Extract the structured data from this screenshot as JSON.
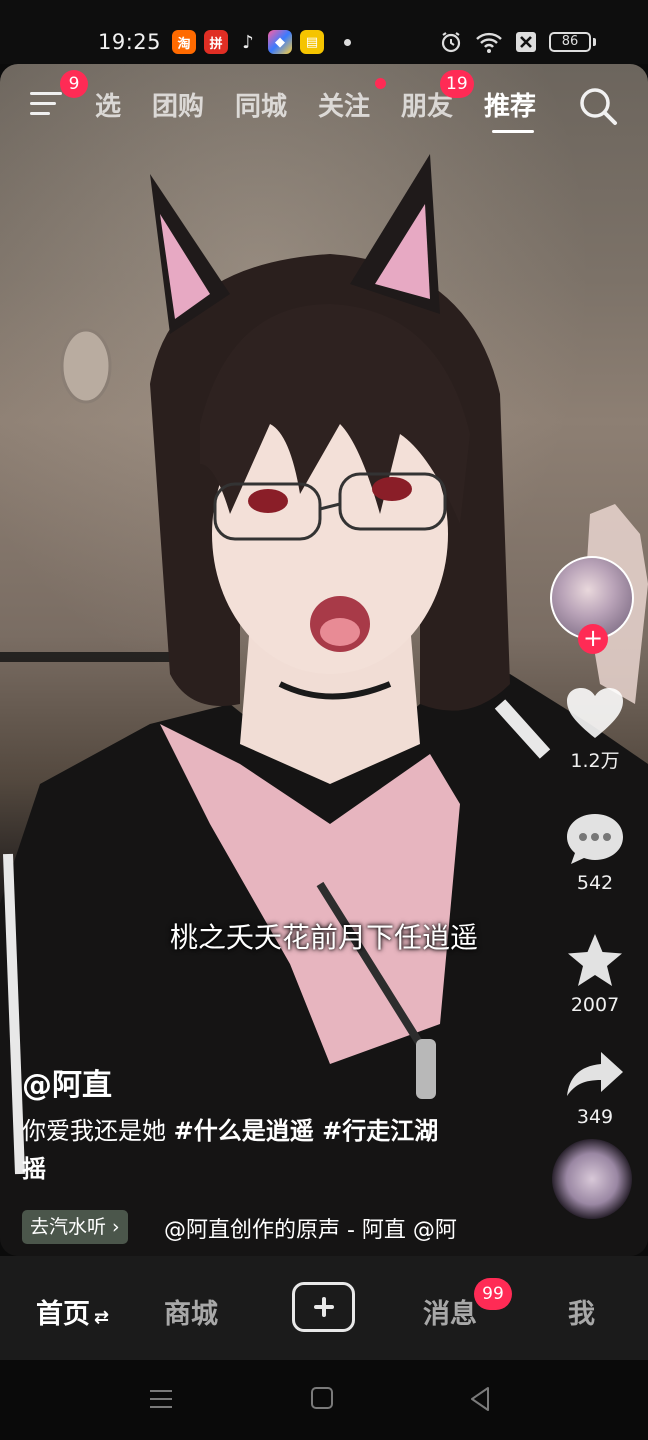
{
  "status_bar": {
    "time": "19:25",
    "app_icons": [
      {
        "name": "taobao-app-icon",
        "color": "#ff6a00",
        "glyph": "淘"
      },
      {
        "name": "pinduoduo-app-icon",
        "color": "#e02e24",
        "glyph": "拼"
      },
      {
        "name": "douyin-app-icon",
        "color": "#111111",
        "glyph": "♪"
      },
      {
        "name": "gallery-app-icon",
        "color": "#3a7bff",
        "glyph": "◆"
      },
      {
        "name": "notes-app-icon",
        "color": "#f5c400",
        "glyph": "▤"
      }
    ],
    "battery": "86"
  },
  "top_nav": {
    "menu_badge": "9",
    "tabs": [
      "精选",
      "团购",
      "同城",
      "关注",
      "朋友",
      "推荐"
    ],
    "tab_visible": [
      "选",
      "团购",
      "同城",
      "关注",
      "朋友",
      "推荐"
    ],
    "active_tab": "推荐",
    "friends_badge": "19"
  },
  "video": {
    "subtitle": "桃之夭夭花前月下任逍遥",
    "author": "@阿直",
    "caption_text": "你爱我还是她 ",
    "hashtag_1": "#什么是逍遥",
    "hashtag_2": " #行走江湖",
    "caption_wrap": "摇",
    "listen_label": "去汽水听 ›",
    "music": "@阿直创作的原声 - 阿直    @阿"
  },
  "actions": {
    "likes": "1.2万",
    "comments": "542",
    "favorites": "2007",
    "shares": "349"
  },
  "bottom_nav": {
    "home": "首页",
    "home_switch": "⇄",
    "mall": "商城",
    "messages": "消息",
    "messages_badge": "99",
    "me": "我"
  },
  "colors": {
    "accent_red": "#ff2b55",
    "nav_bg": "#1b1b1b"
  }
}
